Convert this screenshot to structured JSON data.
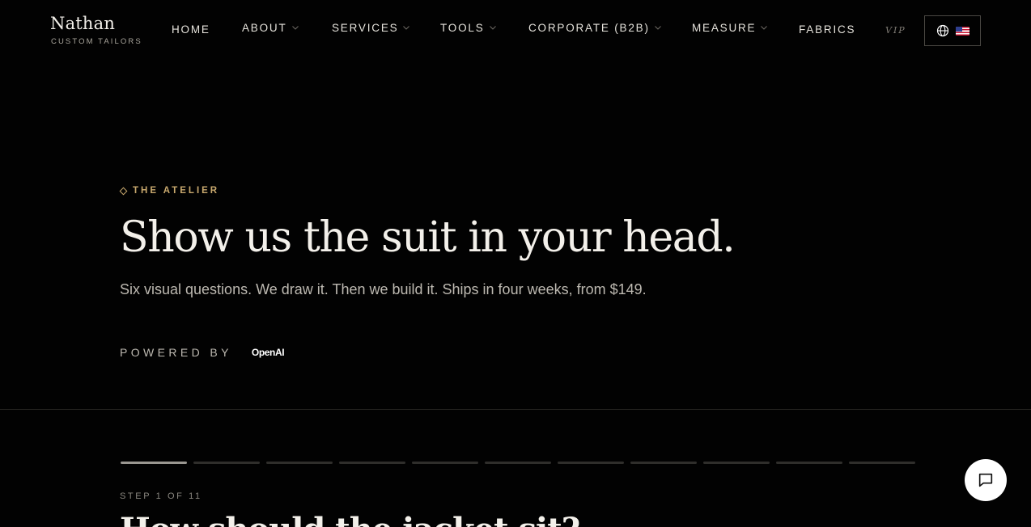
{
  "brand": {
    "name": "Nathan",
    "subtitle": "CUSTOM TAILORS"
  },
  "nav": {
    "home": "HOME",
    "about": "ABOUT",
    "services": "SERVICES",
    "tools": "TOOLS",
    "corporate": "CORPORATE (B2B)",
    "measure": "MEASURE",
    "fabrics": "FABRICS",
    "vip": "VIP",
    "language_flag": "us-flag-icon"
  },
  "hero": {
    "eyebrow": "THE ATELIER",
    "title": "Show us the suit in your head.",
    "subtitle": "Six visual questions. We draw it. Then we build it. Ships in four weeks, from $149.",
    "powered_label": "POWERED BY",
    "powered_logo": "OpenAI"
  },
  "wizard": {
    "progress": {
      "current": 1,
      "total": 11
    },
    "step_label": "STEP 1 OF 11",
    "question": "How should the jacket sit?"
  },
  "colors": {
    "background": "#020202",
    "accent": "#c9a96e",
    "text": "#f3f0ea"
  },
  "icons": {
    "chat": "chat-bubble-icon",
    "language": "globe-icon"
  }
}
